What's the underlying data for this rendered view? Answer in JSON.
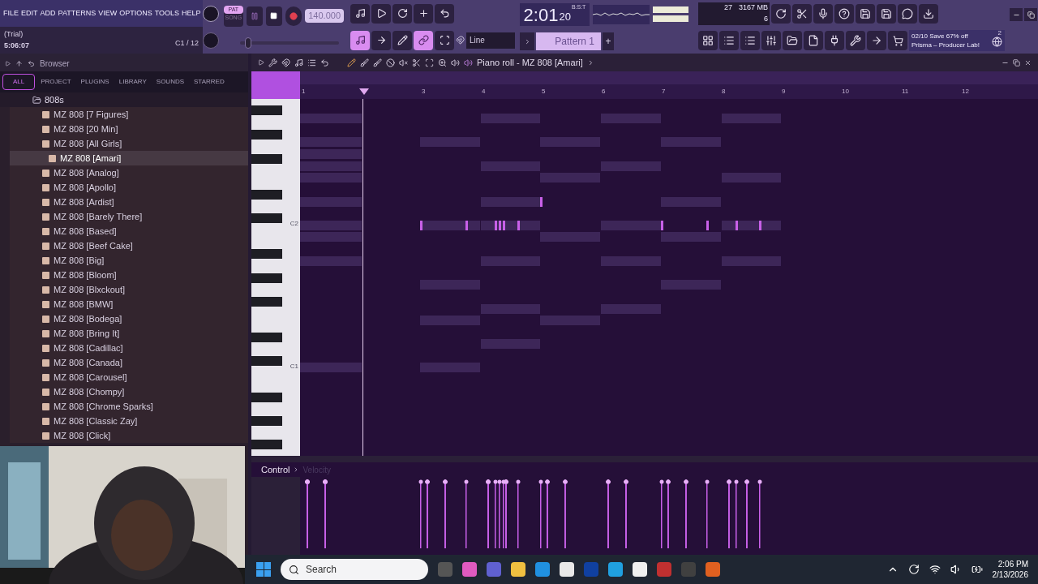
{
  "menu": [
    "FILE",
    "EDIT",
    "ADD",
    "PATTERNS",
    "VIEW",
    "OPTIONS",
    "TOOLS",
    "HELP"
  ],
  "hint_panel": {
    "mode": "(Trial)",
    "time": "5:06:07",
    "channel": "C1 / 12"
  },
  "transport": {
    "pat_label": "PAT",
    "song_label": "SONG",
    "pattern_mode": true,
    "playing": false,
    "tempo": "140.000",
    "time": "2:01",
    "time_small": "20",
    "time_format": "B:S:T"
  },
  "monitor": {
    "polyphony": "27",
    "memory": "3167 MB",
    "cpu": "6"
  },
  "snap": {
    "value": "Line"
  },
  "pattern_slider": {
    "level": 0.08
  },
  "pattern": {
    "name": "Pattern 1",
    "add": "+"
  },
  "news": {
    "line1": "02/10  Save 67% off",
    "line2": "Prisma – Producer Lab!",
    "badge": "2"
  },
  "browser": {
    "title": "Browser",
    "tabs": [
      {
        "label": "ALL",
        "selected": true
      },
      {
        "label": "PROJECT",
        "selected": false
      },
      {
        "label": "PLUGINS",
        "selected": false
      },
      {
        "label": "LIBRARY",
        "selected": false
      },
      {
        "label": "SOUNDS",
        "selected": false
      },
      {
        "label": "STARRED",
        "selected": false
      }
    ],
    "folder": "808s",
    "items": [
      {
        "label": "MZ 808 [7 Figures]",
        "selected": false
      },
      {
        "label": "MZ 808 [20 Min]",
        "selected": false
      },
      {
        "label": "MZ 808 [All Girls]",
        "selected": false
      },
      {
        "label": "MZ 808 [Amari]",
        "selected": true
      },
      {
        "label": "MZ 808 [Analog]",
        "selected": false
      },
      {
        "label": "MZ 808 [Apollo]",
        "selected": false
      },
      {
        "label": "MZ 808 [Ardist]",
        "selected": false
      },
      {
        "label": "MZ 808 [Barely There]",
        "selected": false
      },
      {
        "label": "MZ 808 [Based]",
        "selected": false
      },
      {
        "label": "MZ 808 [Beef Cake]",
        "selected": false
      },
      {
        "label": "MZ 808 [Big]",
        "selected": false
      },
      {
        "label": "MZ 808 [Bloom]",
        "selected": false
      },
      {
        "label": "MZ 808 [Blxckout]",
        "selected": false
      },
      {
        "label": "MZ 808 [BMW]",
        "selected": false
      },
      {
        "label": "MZ 808 [Bodega]",
        "selected": false
      },
      {
        "label": "MZ 808 [Bring It]",
        "selected": false
      },
      {
        "label": "MZ 808 [Cadillac]",
        "selected": false
      },
      {
        "label": "MZ 808 [Canada]",
        "selected": false
      },
      {
        "label": "MZ 808 [Carousel]",
        "selected": false
      },
      {
        "label": "MZ 808 [Chompy]",
        "selected": false
      },
      {
        "label": "MZ 808 [Chrome Sparks]",
        "selected": false
      },
      {
        "label": "MZ 808 [Classic Zay]",
        "selected": false
      },
      {
        "label": "MZ 808 [Click]",
        "selected": false
      }
    ]
  },
  "piano_roll": {
    "title": "Piano roll - MZ 808 [Amari]",
    "key_labels": [
      "C2",
      "C1"
    ],
    "bars": [
      "1",
      "3",
      "4",
      "5",
      "6",
      "7",
      "8",
      "9",
      "10",
      "11",
      "12"
    ],
    "control_label": "Control",
    "control_target": "Velocity"
  },
  "taskbar": {
    "search": "Search",
    "clock_time": "2:06 PM",
    "clock_date": "2/13/2026"
  }
}
